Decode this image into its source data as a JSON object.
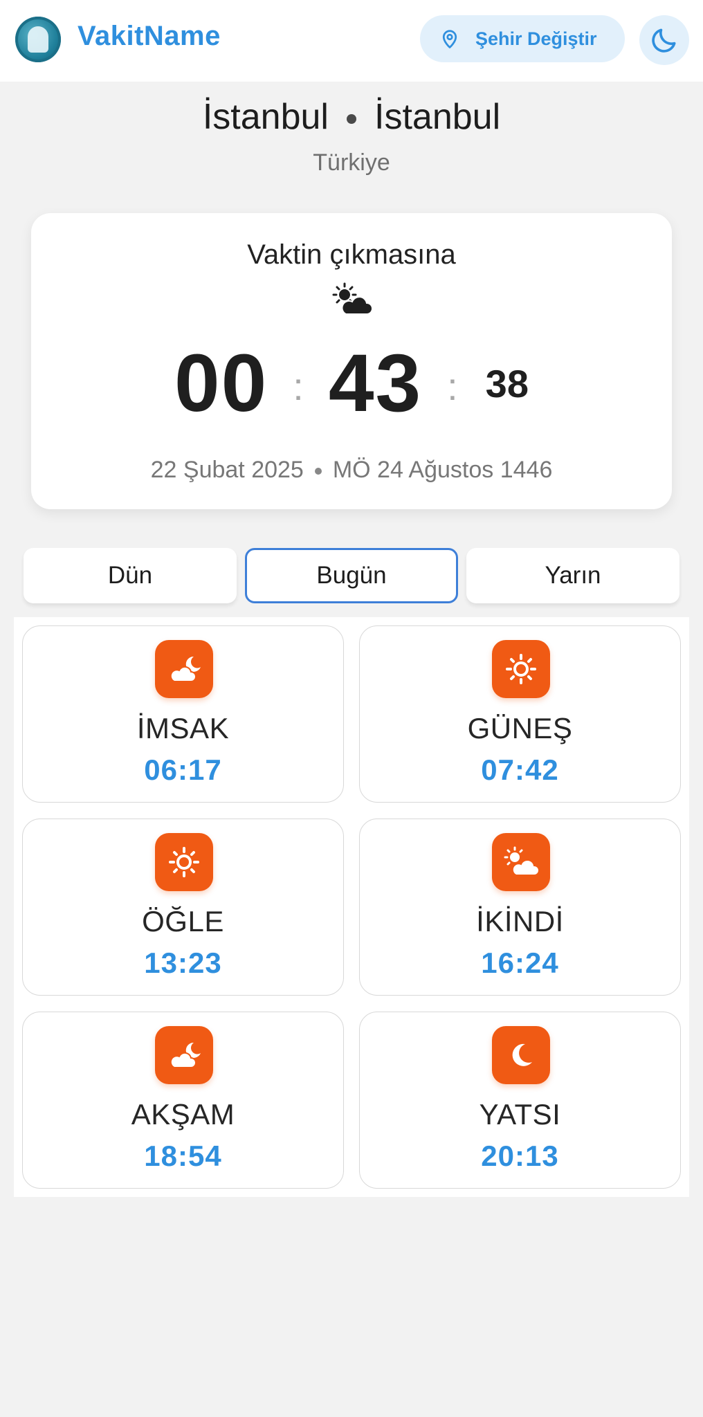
{
  "header": {
    "brand": "VakitName",
    "change_city_label": "Şehir Değiştir"
  },
  "location": {
    "city": "İstanbul",
    "district": "İstanbul",
    "country": "Türkiye"
  },
  "countdown": {
    "title": "Vaktin çıkmasına",
    "weather_icon": "sun-cloud-icon",
    "hours": "00",
    "minutes": "43",
    "seconds": "38",
    "gregorian_date": "22 Şubat 2025",
    "hijri_date": "MÖ 24 Ağustos 1446"
  },
  "tabs": {
    "yesterday": "Dün",
    "today": "Bugün",
    "tomorrow": "Yarın",
    "active": "today"
  },
  "prayers": [
    {
      "name": "İMSAK",
      "time": "06:17",
      "icon": "moon-cloud-icon"
    },
    {
      "name": "GÜNEŞ",
      "time": "07:42",
      "icon": "sun-icon"
    },
    {
      "name": "ÖĞLE",
      "time": "13:23",
      "icon": "sun-icon"
    },
    {
      "name": "İKİNDİ",
      "time": "16:24",
      "icon": "sun-cloud-icon"
    },
    {
      "name": "AKŞAM",
      "time": "18:54",
      "icon": "moon-cloud-icon"
    },
    {
      "name": "YATSI",
      "time": "20:13",
      "icon": "moon-icon"
    }
  ],
  "colors": {
    "accent": "#2f8fde",
    "icon_bg": "#f05a14",
    "active_tab_border": "#3e7fd8"
  }
}
